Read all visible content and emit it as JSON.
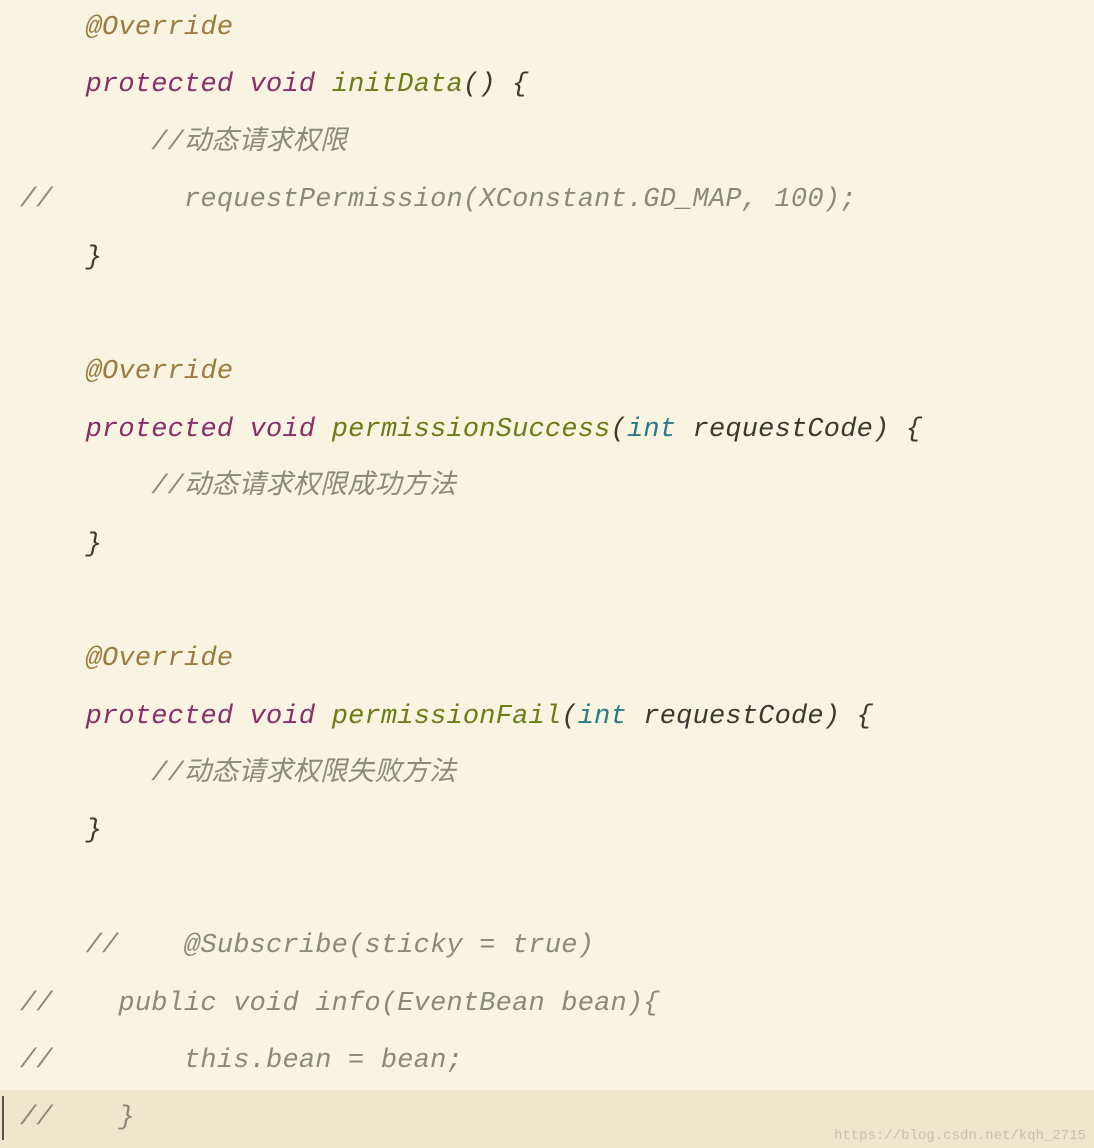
{
  "colors": {
    "background": "#f9f3e1",
    "current_line": "#efe7cc",
    "annotation": "#9a7c3f",
    "keyword": "#8a2d6a",
    "method": "#6a7d19",
    "comment": "#8a8a78",
    "builtin_type": "#2a7a8a",
    "default_text": "#3a3a30",
    "gutter": "#c7bfa5"
  },
  "watermark": "https://blog.csdn.net/kqh_2715",
  "code": {
    "l1": {
      "annotation": "@Override"
    },
    "l2": {
      "kw_protected": "protected",
      "kw_void": "void",
      "method": "initData",
      "parens": "()",
      "brace_open": " {"
    },
    "l3": {
      "comment": "//动态请求权限"
    },
    "l4": {
      "comment": "//        requestPermission(XConstant.GD_MAP, 100);"
    },
    "l5": {
      "brace_close": "}"
    },
    "l6": {
      "blank": ""
    },
    "l7": {
      "annotation": "@Override"
    },
    "l8": {
      "kw_protected": "protected",
      "kw_void": "void",
      "method": "permissionSuccess",
      "paren_open": "(",
      "kw_int": "int",
      "param": " requestCode",
      "paren_close": ")",
      "brace_open": " {"
    },
    "l9": {
      "comment": "//动态请求权限成功方法"
    },
    "l10": {
      "brace_close": "}"
    },
    "l11": {
      "blank": ""
    },
    "l12": {
      "annotation": "@Override"
    },
    "l13": {
      "kw_protected": "protected",
      "kw_void": "void",
      "method": "permissionFail",
      "paren_open": "(",
      "kw_int": "int",
      "param": " requestCode",
      "paren_close": ")",
      "brace_open": " {"
    },
    "l14": {
      "comment": "//动态请求权限失败方法"
    },
    "l15": {
      "brace_close": "}"
    },
    "l16": {
      "blank": ""
    },
    "l17": {
      "comment": "//    @Subscribe(sticky = true)"
    },
    "l18": {
      "comment": "//    public void info(EventBean bean){"
    },
    "l19": {
      "comment": "//        this.bean = bean;"
    },
    "l20": {
      "comment": "//    }"
    }
  }
}
